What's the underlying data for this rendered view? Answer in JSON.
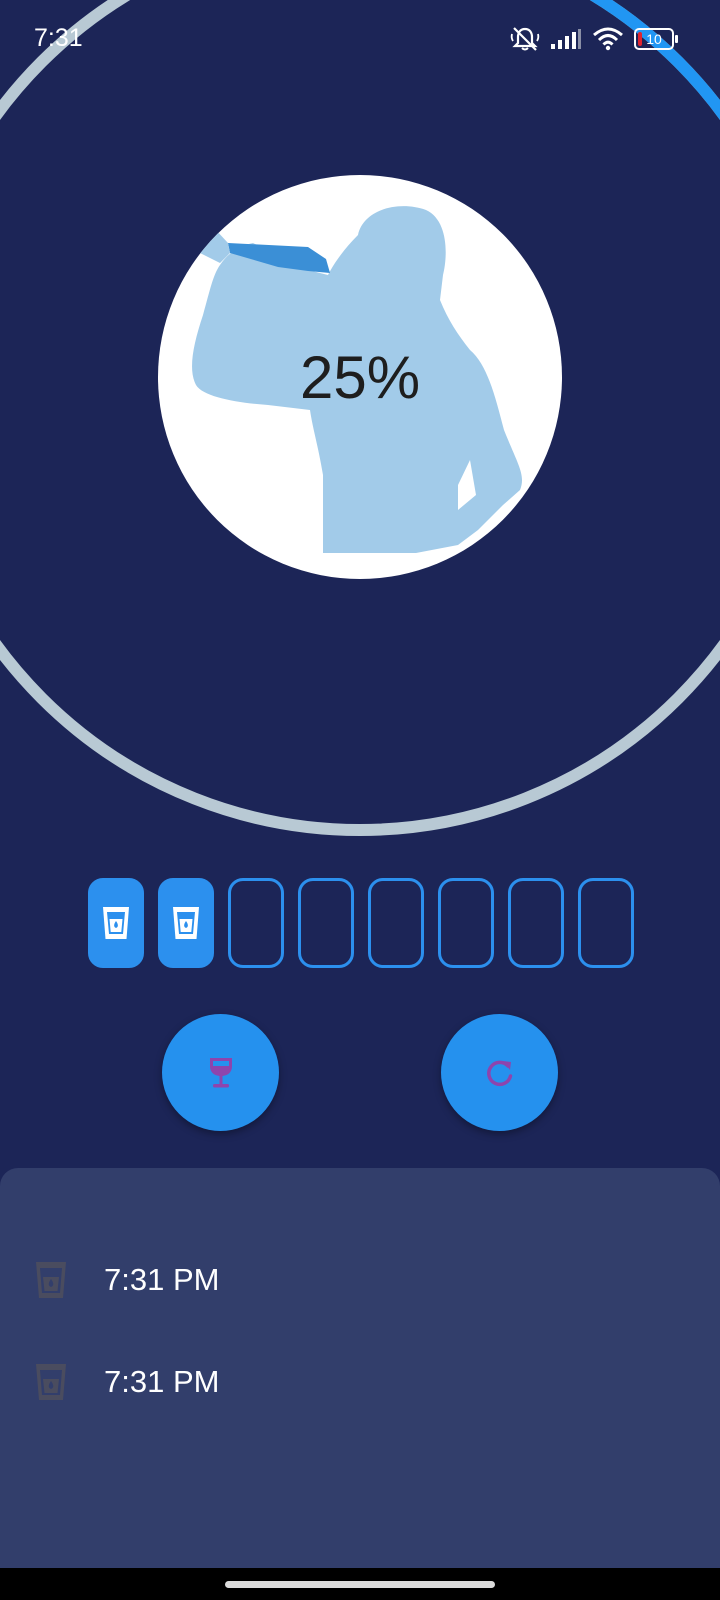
{
  "status_bar": {
    "time": "7:31",
    "battery_level": "10",
    "icons": [
      "mute-notifications-icon",
      "signal-icon",
      "wifi-icon",
      "battery-icon"
    ]
  },
  "progress": {
    "label": "25%",
    "fraction": 0.25,
    "track_color": "#b8c9d4",
    "fill_color": "#2196f3"
  },
  "cups": {
    "total": 8,
    "filled": 2,
    "icon": "water-glass-icon"
  },
  "actions": {
    "drink_icon": "wine-glass-icon",
    "reset_icon": "refresh-icon"
  },
  "history": {
    "items": [
      {
        "time": "7:31 PM",
        "icon": "water-glass-icon"
      },
      {
        "time": "7:31 PM",
        "icon": "water-glass-icon"
      }
    ]
  },
  "colors": {
    "background": "#1c2557",
    "accent": "#2591ee",
    "panel": "#323e6b"
  }
}
